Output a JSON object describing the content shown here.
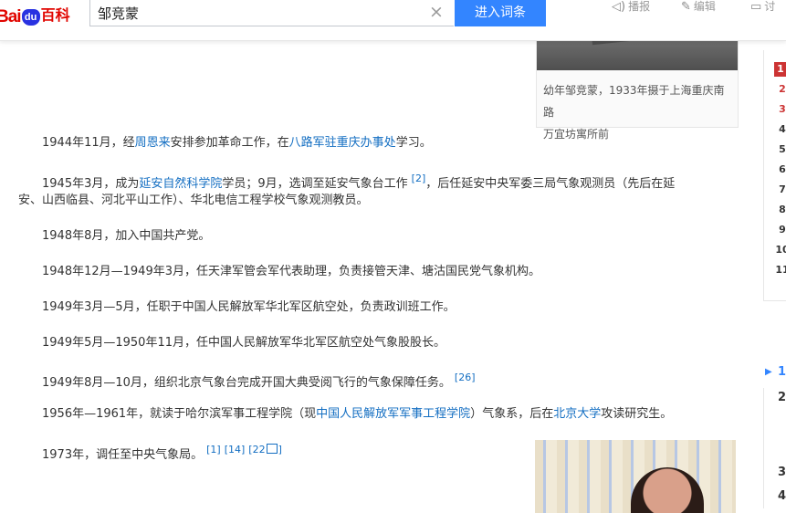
{
  "header": {
    "logo_text_1": "Bai",
    "logo_text_2": "du",
    "logo_text_3": "百科",
    "search_value": "邹竞蒙",
    "clear_icon": "×",
    "enter_button": "进入词条",
    "tools": [
      {
        "icon": "speaker-icon",
        "label": "播报"
      },
      {
        "icon": "pencil-icon",
        "label": "编辑"
      },
      {
        "icon": "comment-icon",
        "label": "讨"
      }
    ]
  },
  "figure_top": {
    "caption_line1": "幼年邹竞蒙，1933年摄于上海重庆南路",
    "caption_line2": "万宜坊寓所前"
  },
  "content": {
    "p1": {
      "a": "1944年11月，经",
      "link1": "周恩来",
      "b": "安排参加革命工作，在",
      "link2": "八路军驻重庆办事处",
      "c": "学习。"
    },
    "p2": {
      "a": "1945年3月，成为",
      "link1": "延安自然科学院",
      "b": "学员；9月，选调至延安气象台工作",
      "ref": "[2]",
      "c": "，后任延安中央军委三局气象观测员（先后在延",
      "line2": "安、山西临县、河北平山工作）、华北电信工程学校气象观测教员。"
    },
    "p3": "1948年8月，加入中国共产党。",
    "p4": "1948年12月—1949年3月，任天津军管会军代表助理，负责接管天津、塘沽国民党气象机构。",
    "p5": "1949年3月—5月，任职于中国人民解放军华北军区航空处，负责政训班工作。",
    "p6": "1949年5月—1950年11月，任中国人民解放军华北军区航空处气象股股长。",
    "p7": {
      "a": "1949年8月—10月，组织北京气象台完成开国大典受阅飞行的气象保障任务。",
      "ref": "[26]"
    },
    "p8": {
      "a": "1956年—1961年，就读于哈尔滨军事工程学院（现",
      "link1": "中国人民解放军军事工程学院",
      "b": "）气象系，后在",
      "link2": "北京大学",
      "c": "攻读研究生。"
    },
    "p9": {
      "a": "1973年，调任至中央气象局。",
      "ref1": "[1]",
      "ref2": "[14]",
      "ref3": "[22",
      "ref3_end": "]"
    }
  },
  "catalog": {
    "items": [
      "1",
      "2",
      "3",
      "4",
      "5",
      "6",
      "7",
      "8",
      "9",
      "10",
      "11"
    ],
    "section2": [
      "1",
      "2",
      "3",
      "4"
    ]
  }
}
